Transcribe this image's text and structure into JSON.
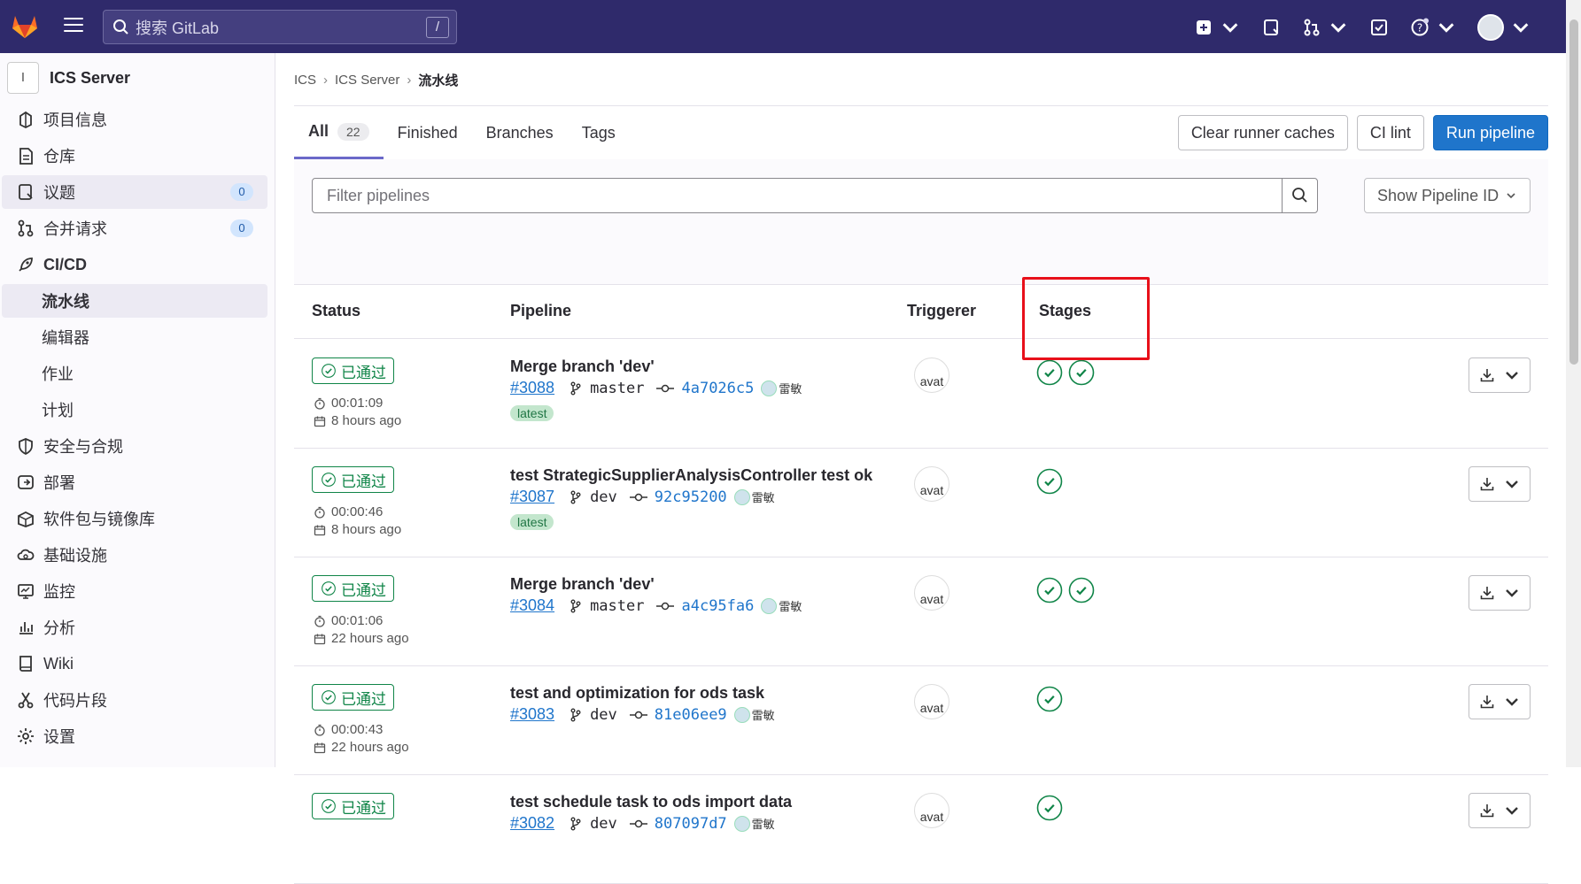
{
  "topbar": {
    "search_placeholder": "搜索 GitLab",
    "search_shortcut": "/"
  },
  "sidebar": {
    "project_initial": "I",
    "project_name": "ICS Server",
    "items": [
      {
        "label": "项目信息",
        "icon": "project-icon"
      },
      {
        "label": "仓库",
        "icon": "document-icon"
      },
      {
        "label": "议题",
        "icon": "issues-icon",
        "count": "0"
      },
      {
        "label": "合并请求",
        "icon": "merge-request-icon",
        "count": "0"
      },
      {
        "label": "CI/CD",
        "icon": "rocket-icon"
      },
      {
        "label": "流水线"
      },
      {
        "label": "编辑器"
      },
      {
        "label": "作业"
      },
      {
        "label": "计划"
      },
      {
        "label": "安全与合规",
        "icon": "shield-icon"
      },
      {
        "label": "部署",
        "icon": "deploy-icon"
      },
      {
        "label": "软件包与镜像库",
        "icon": "package-icon"
      },
      {
        "label": "基础设施",
        "icon": "cloud-gear-icon"
      },
      {
        "label": "监控",
        "icon": "monitor-icon"
      },
      {
        "label": "分析",
        "icon": "chart-icon"
      },
      {
        "label": "Wiki",
        "icon": "book-icon"
      },
      {
        "label": "代码片段",
        "icon": "snippet-icon"
      },
      {
        "label": "设置",
        "icon": "gear-icon"
      }
    ]
  },
  "breadcrumb": {
    "a": "ICS",
    "b": "ICS Server",
    "current": "流水线"
  },
  "tabs": {
    "all": "All",
    "all_count": "22",
    "finished": "Finished",
    "branches": "Branches",
    "tags": "Tags"
  },
  "actions": {
    "clear": "Clear runner caches",
    "lint": "CI lint",
    "run": "Run pipeline"
  },
  "filter": {
    "placeholder": "Filter pipelines",
    "show_id": "Show Pipeline ID"
  },
  "table": {
    "headers": {
      "status": "Status",
      "pipeline": "Pipeline",
      "triggerer": "Triggerer",
      "stages": "Stages"
    },
    "rows": [
      {
        "status": "已通过",
        "duration": "00:01:09",
        "ago": "8 hours ago",
        "title": "Merge branch 'dev'",
        "id": "#3088",
        "branch": "master",
        "sha": "4a7026c5",
        "user": "雷敏",
        "latest": "latest",
        "avatar_alt": "avat",
        "stages": 2
      },
      {
        "status": "已通过",
        "duration": "00:00:46",
        "ago": "8 hours ago",
        "title": "test StrategicSupplierAnalysisController test ok",
        "id": "#3087",
        "branch": "dev",
        "sha": "92c95200",
        "user": "雷敏",
        "latest": "latest",
        "avatar_alt": "avat",
        "stages": 1
      },
      {
        "status": "已通过",
        "duration": "00:01:06",
        "ago": "22 hours ago",
        "title": "Merge branch 'dev'",
        "id": "#3084",
        "branch": "master",
        "sha": "a4c95fa6",
        "user": "雷敏",
        "avatar_alt": "avat",
        "stages": 2
      },
      {
        "status": "已通过",
        "duration": "00:00:43",
        "ago": "22 hours ago",
        "title": "test and optimization for ods task",
        "id": "#3083",
        "branch": "dev",
        "sha": "81e06ee9",
        "user": "雷敏",
        "avatar_alt": "avat",
        "stages": 1
      },
      {
        "status": "已通过",
        "title": "test schedule task to ods import data",
        "id": "#3082",
        "branch": "dev",
        "sha": "807097d7",
        "user": "雷敏",
        "avatar_alt": "avat",
        "stages": 1
      }
    ]
  },
  "colors": {
    "topbar": "#2f2a6b",
    "success": "#108548",
    "primary": "#1f75cb",
    "highlight": "#e8101a"
  }
}
